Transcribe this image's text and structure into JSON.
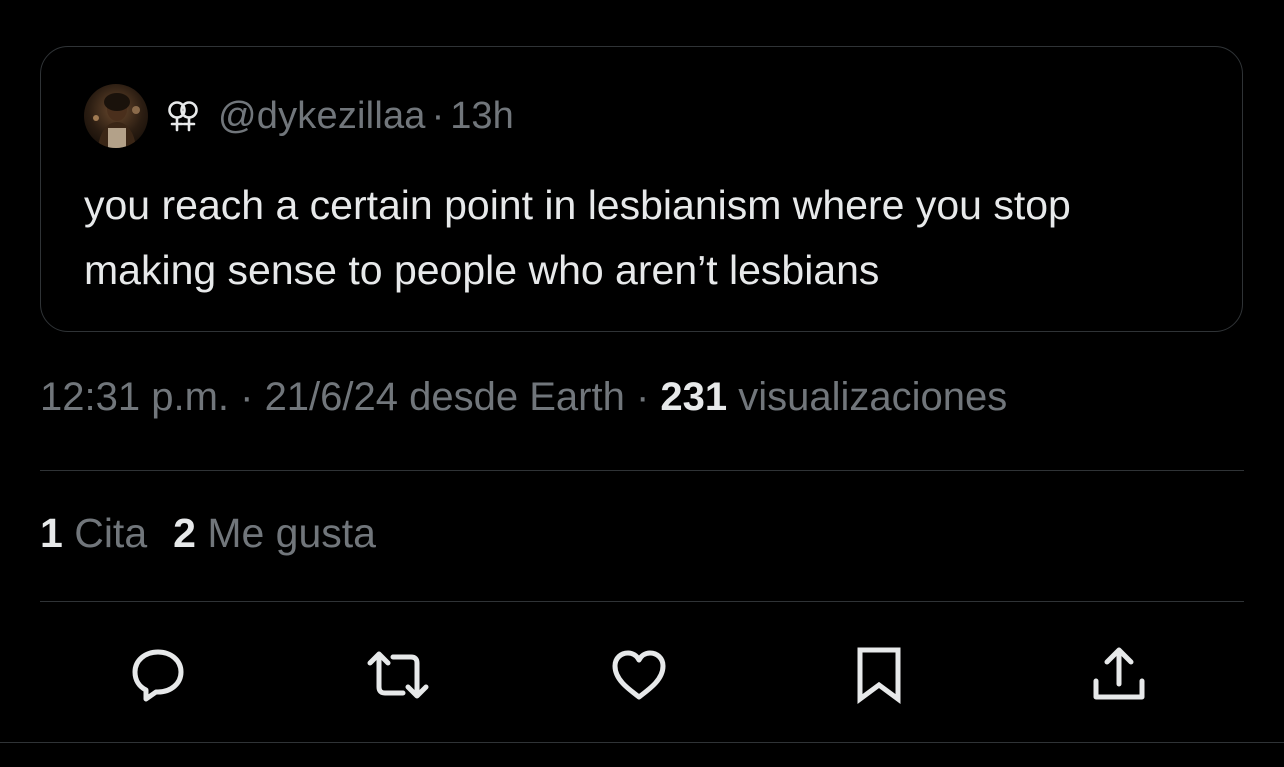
{
  "quote": {
    "avatar_icon": "user-avatar-photo",
    "badge_icon": "double-female-symbol-icon",
    "handle": "@dykezillaa",
    "separator": "·",
    "time": "13h",
    "text": "you reach a certain point in lesbianism where you stop making sense to people who aren’t lesbians"
  },
  "meta": {
    "time": "12:31 p.m.",
    "sep1": " · ",
    "date_source": "21/6/24 desde Earth",
    "sep2": " · ",
    "views_count": "231",
    "views_label": " visualizaciones"
  },
  "stats": {
    "quotes_count": "1",
    "quotes_label": " Cita",
    "likes_count": "2",
    "likes_label": " Me gusta"
  },
  "actions": {
    "reply_icon": "reply-icon",
    "retweet_icon": "retweet-icon",
    "like_icon": "heart-icon",
    "bookmark_icon": "bookmark-icon",
    "share_icon": "share-icon"
  },
  "colors": {
    "background": "#000000",
    "primary_text": "#e7e9ea",
    "secondary_text": "#71767b",
    "border": "#2f3336"
  }
}
